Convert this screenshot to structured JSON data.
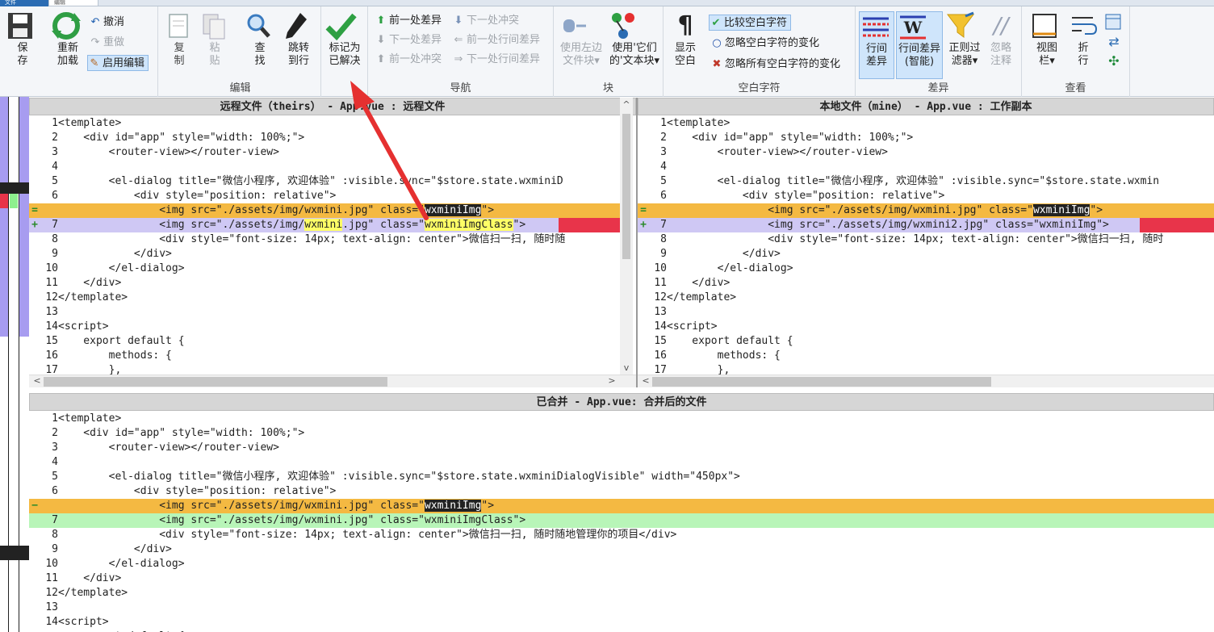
{
  "tabs": {
    "file": "文件",
    "edit": "编辑"
  },
  "ribbon": {
    "save": {
      "label": "保\n存"
    },
    "reload": {
      "label": "重新\n加载"
    },
    "undo": "撤消",
    "redo": "重做",
    "enable_edit": "启用编辑",
    "copy": "复\n制",
    "paste": "粘\n贴",
    "find": "查\n找",
    "goto": "跳转\n到行",
    "mark_resolved": "标记为\n已解决",
    "edit_group": "编辑",
    "nav": {
      "prev_diff": "前一处差异",
      "next_diff": "下一处差异",
      "prev_conflict": "前一处冲突",
      "next_conflict": "下一处冲突",
      "prev_inline": "前一处行间差异",
      "next_inline": "下一处行间差异",
      "group": "导航"
    },
    "block": {
      "use_left": "使用左边\n文件块▾",
      "use_theirs": "使用'它们\n的'文本块▾",
      "group": "块"
    },
    "whitespace": {
      "show": "显示\n空白",
      "compare": "比较空白字符",
      "ignore_change": "忽略空白字符的变化",
      "ignore_all": "忽略所有空白字符的变化",
      "group": "空白字符"
    },
    "diff": {
      "inline": "行间\n差异",
      "inline_smart": "行间差异\n(智能)",
      "regex_filter": "正则过\n滤器▾",
      "ignore_comments": "忽略\n注释",
      "group": "差异"
    },
    "view": {
      "viewbar": "视图\n栏▾",
      "wrap": "折\n行",
      "group": "查看"
    }
  },
  "panes": {
    "theirs_title": "远程文件（theirs） - App.vue : 远程文件",
    "mine_title": "本地文件（mine） - App.vue : 工作副本",
    "merged_title": "已合并 - App.vue: 合并后的文件"
  },
  "theirs_lines": [
    {
      "n": "1",
      "t": "<template>"
    },
    {
      "n": "2",
      "t": "    <div id=\"app\" style=\"width: 100%;\">"
    },
    {
      "n": "3",
      "t": "        <router-view></router-view>"
    },
    {
      "n": "4",
      "t": ""
    },
    {
      "n": "5",
      "t": "        <el-dialog title=\"微信小程序, 欢迎体验\" :visible.sync=\"$store.state.wxminiD"
    },
    {
      "n": "6",
      "t": "            <div style=\"position: relative\">"
    },
    {
      "n": "",
      "m": "=",
      "t": "                <img src=\"./assets/img/wxmini.jpg\" class=\"wxminiImg\">"
    },
    {
      "n": "7",
      "m": "+",
      "t": "                <img src=\"./assets/img/wxmini.jpg\" class=\"wxminiImgClass\">"
    },
    {
      "n": "8",
      "t": "                <div style=\"font-size: 14px; text-align: center\">微信扫一扫, 随时随"
    },
    {
      "n": "9",
      "t": "            </div>"
    },
    {
      "n": "10",
      "t": "        </el-dialog>"
    },
    {
      "n": "11",
      "t": "    </div>"
    },
    {
      "n": "12",
      "t": "</template>"
    },
    {
      "n": "13",
      "t": ""
    },
    {
      "n": "14",
      "t": "<script>"
    },
    {
      "n": "15",
      "t": "    export default {"
    },
    {
      "n": "16",
      "t": "        methods: {"
    },
    {
      "n": "17",
      "t": "        },"
    }
  ],
  "mine_lines": [
    {
      "n": "1",
      "t": "<template>"
    },
    {
      "n": "2",
      "t": "    <div id=\"app\" style=\"width: 100%;\">"
    },
    {
      "n": "3",
      "t": "        <router-view></router-view>"
    },
    {
      "n": "4",
      "t": ""
    },
    {
      "n": "5",
      "t": "        <el-dialog title=\"微信小程序, 欢迎体验\" :visible.sync=\"$store.state.wxmin"
    },
    {
      "n": "6",
      "t": "            <div style=\"position: relative\">"
    },
    {
      "n": "",
      "m": "=",
      "t": "                <img src=\"./assets/img/wxmini.jpg\" class=\"wxminiImg\">"
    },
    {
      "n": "7",
      "m": "+",
      "t": "                <img src=\"./assets/img/wxmini2.jpg\" class=\"wxminiImg\">"
    },
    {
      "n": "8",
      "t": "                <div style=\"font-size: 14px; text-align: center\">微信扫一扫, 随时"
    },
    {
      "n": "9",
      "t": "            </div>"
    },
    {
      "n": "10",
      "t": "        </el-dialog>"
    },
    {
      "n": "11",
      "t": "    </div>"
    },
    {
      "n": "12",
      "t": "</template>"
    },
    {
      "n": "13",
      "t": ""
    },
    {
      "n": "14",
      "t": "<script>"
    },
    {
      "n": "15",
      "t": "    export default {"
    },
    {
      "n": "16",
      "t": "        methods: {"
    },
    {
      "n": "17",
      "t": "        },"
    }
  ],
  "merged_lines": [
    {
      "n": "1",
      "t": "<template>"
    },
    {
      "n": "2",
      "t": "    <div id=\"app\" style=\"width: 100%;\">"
    },
    {
      "n": "3",
      "t": "        <router-view></router-view>"
    },
    {
      "n": "4",
      "t": ""
    },
    {
      "n": "5",
      "t": "        <el-dialog title=\"微信小程序, 欢迎体验\" :visible.sync=\"$store.state.wxminiDialogVisible\" width=\"450px\">"
    },
    {
      "n": "6",
      "t": "            <div style=\"position: relative\">"
    },
    {
      "n": "",
      "m": "−",
      "t": "                <img src=\"./assets/img/wxmini.jpg\" class=\"wxminiImg\">"
    },
    {
      "n": "7",
      "t": "                <img src=\"./assets/img/wxmini.jpg\" class=\"wxminiImgClass\">"
    },
    {
      "n": "8",
      "t": "                <div style=\"font-size: 14px; text-align: center\">微信扫一扫, 随时随地管理你的项目</div>"
    },
    {
      "n": "9",
      "t": "            </div>"
    },
    {
      "n": "10",
      "t": "        </el-dialog>"
    },
    {
      "n": "11",
      "t": "    </div>"
    },
    {
      "n": "12",
      "t": "</template>"
    },
    {
      "n": "13",
      "t": ""
    },
    {
      "n": "14",
      "t": "<script>"
    },
    {
      "n": "",
      "t": "    export default {"
    }
  ],
  "colors": {
    "conflict": "#f4b942",
    "theirs_add": "#cfc8f4",
    "merged_resolved": "#b8f5b8",
    "inline_change": "#e8344a",
    "annotation_arrow": "#e53030"
  }
}
